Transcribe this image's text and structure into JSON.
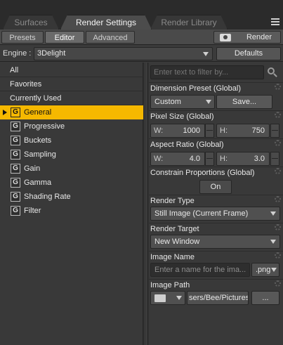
{
  "tabs": {
    "surfaces": "Surfaces",
    "render_settings": "Render Settings",
    "render_library": "Render Library"
  },
  "subtabs": {
    "presets": "Presets",
    "editor": "Editor",
    "advanced": "Advanced",
    "render": "Render"
  },
  "engine": {
    "label": "Engine :",
    "value": "3Delight",
    "defaults": "Defaults"
  },
  "left_list": {
    "all": "All",
    "favorites": "Favorites",
    "currently_used": "Currently Used",
    "groups": [
      {
        "icon": "G",
        "label": "General"
      },
      {
        "icon": "G",
        "label": "Progressive"
      },
      {
        "icon": "G",
        "label": "Buckets"
      },
      {
        "icon": "G",
        "label": "Sampling"
      },
      {
        "icon": "G",
        "label": "Gain"
      },
      {
        "icon": "G",
        "label": "Gamma"
      },
      {
        "icon": "G",
        "label": "Shading Rate"
      },
      {
        "icon": "G",
        "label": "Filter"
      }
    ]
  },
  "filter": {
    "placeholder": "Enter text to filter by..."
  },
  "properties": {
    "dimension_preset": {
      "title": "Dimension Preset (Global)",
      "value": "Custom",
      "save": "Save..."
    },
    "pixel_size": {
      "title": "Pixel Size (Global)",
      "w_label": "W:",
      "w_value": "1000",
      "h_label": "H:",
      "h_value": "750"
    },
    "aspect_ratio": {
      "title": "Aspect Ratio (Global)",
      "w_label": "W:",
      "w_value": "4.0",
      "h_label": "H:",
      "h_value": "3.0"
    },
    "constrain": {
      "title": "Constrain Proportions (Global)",
      "value": "On"
    },
    "render_type": {
      "title": "Render Type",
      "value": "Still Image (Current Frame)"
    },
    "render_target": {
      "title": "Render Target",
      "value": "New Window"
    },
    "image_name": {
      "title": "Image Name",
      "placeholder": "Enter a name for the ima...",
      "ext": ".png"
    },
    "image_path": {
      "title": "Image Path",
      "value": "sers/Bee/Pictures",
      "browse": "..."
    }
  },
  "colors": {
    "selection": "#f5b800",
    "panel": "#393939",
    "background": "#3b3b3b"
  }
}
